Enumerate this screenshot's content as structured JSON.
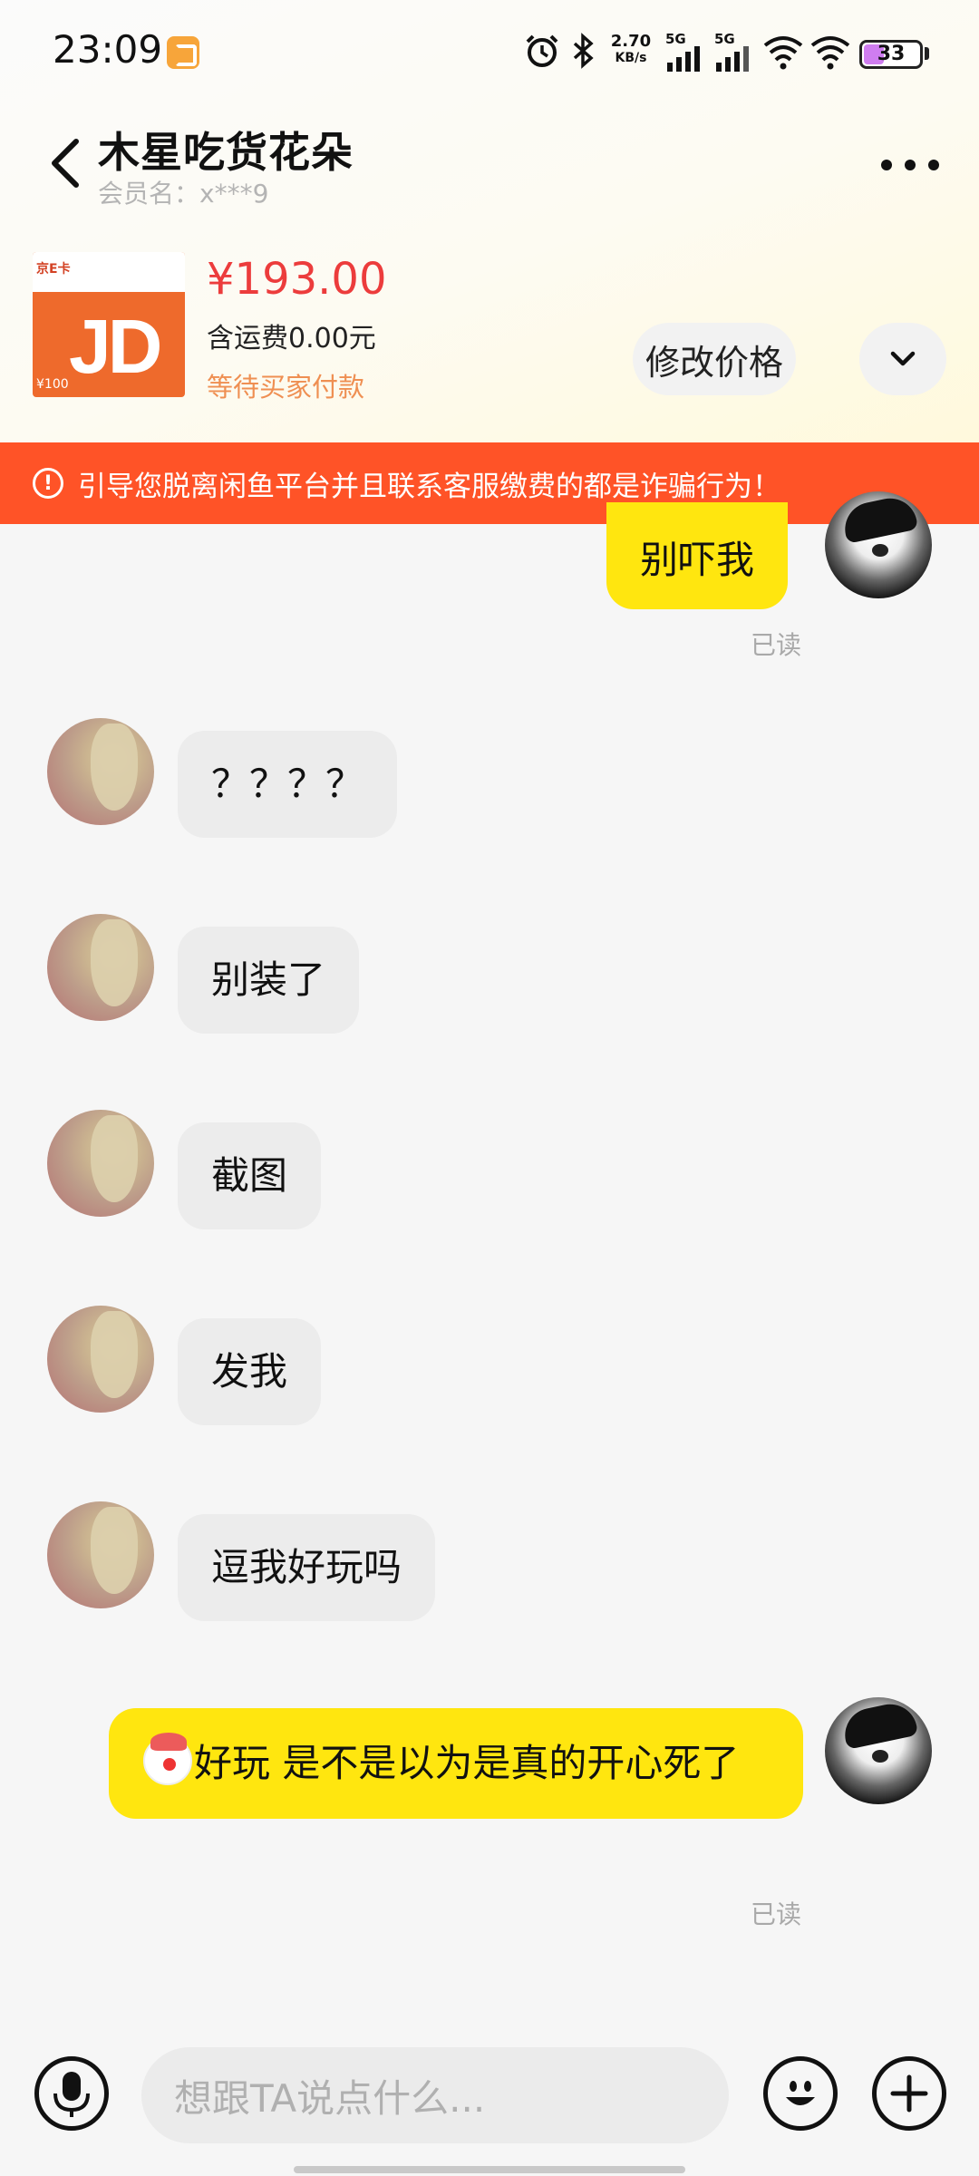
{
  "status_bar": {
    "time": "23:09",
    "net_speed_value": "2.70",
    "net_speed_unit": "KB/s",
    "sim1": "5G",
    "sim2": "5G",
    "battery": "33"
  },
  "header": {
    "title": "木星吃货花朵",
    "member_label": "会员名：x***9"
  },
  "product": {
    "image_brand": "京E卡",
    "image_logo": "JD",
    "image_value": "¥100",
    "price": "¥193.00",
    "shipping": "含运费0.00元",
    "status": "等待买家付款",
    "modify_price_button": "修改价格"
  },
  "warning": {
    "icon": "!",
    "text": "引导您脱离闲鱼平台并且联系客服缴费的都是诈骗行为！"
  },
  "messages": [
    {
      "sender": "me",
      "text": "别吓我",
      "read": "已读"
    },
    {
      "sender": "other",
      "text": "？？？？"
    },
    {
      "sender": "other",
      "text": "别装了"
    },
    {
      "sender": "other",
      "text": "截图"
    },
    {
      "sender": "other",
      "text": "发我"
    },
    {
      "sender": "other",
      "text": "逗我好玩吗"
    },
    {
      "sender": "me",
      "emoji": "clown-face",
      "text": "好玩  是不是以为是真的开心死了",
      "read": "已读"
    }
  ],
  "input": {
    "placeholder": "想跟TA说点什么..."
  },
  "colors": {
    "accent_yellow": "#ffe60f",
    "price_red": "#ec3c3c",
    "warning_orange": "#ff5327",
    "status_orange": "#ef8f52"
  },
  "icons": [
    "back-arrow-icon",
    "more-icon",
    "chevron-down-icon",
    "alarm-icon",
    "bluetooth-icon",
    "signal-icon",
    "wifi-icon",
    "battery-icon",
    "microphone-icon",
    "emoji-icon",
    "plus-icon",
    "warning-icon"
  ]
}
